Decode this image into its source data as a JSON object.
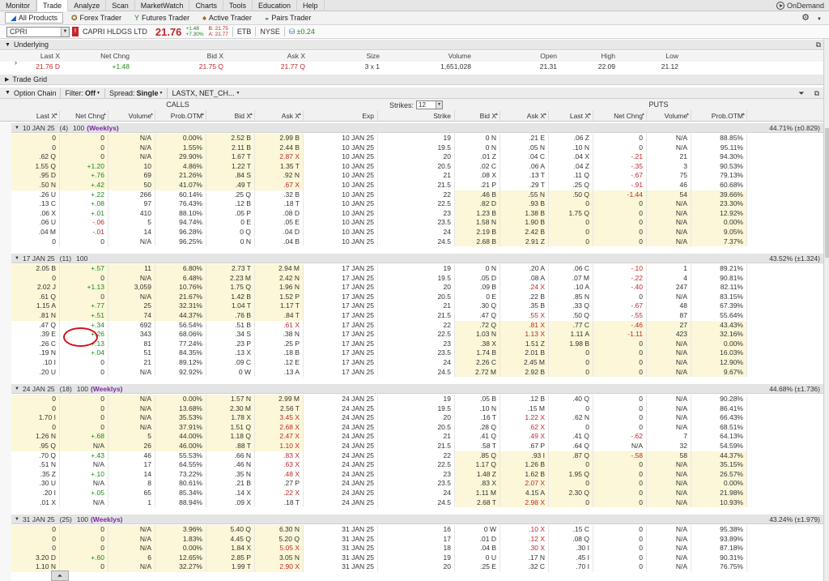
{
  "menu": [
    "Monitor",
    "Trade",
    "Analyze",
    "Scan",
    "MarketWatch",
    "Charts",
    "Tools",
    "Education",
    "Help"
  ],
  "menu_active": "Trade",
  "ondemand": "OnDemand",
  "product_tabs": [
    {
      "label": "All Products",
      "icon": "chart-icon",
      "selected": true
    },
    {
      "label": "Forex Trader",
      "icon": "forex-icon",
      "selected": false
    },
    {
      "label": "Futures Trader",
      "icon": "futures-icon",
      "selected": false
    },
    {
      "label": "Active Trader",
      "icon": "active-trader-icon",
      "selected": false
    },
    {
      "label": "Pairs Trader",
      "icon": "pairs-icon",
      "selected": false
    }
  ],
  "symbol": {
    "ticker": "CPRI",
    "company": "CAPRI HLDGS LTD",
    "last": "21.76",
    "change": "+1.48",
    "change_pct": "+7.30%",
    "bid": "B: 21.75",
    "ask": "A: 21.77",
    "etb": "ETB",
    "exchange": "NYSE",
    "net": "±0.24"
  },
  "underlying": {
    "title": "Underlying",
    "headers": [
      "Last X",
      "Net Chng",
      "Bid X",
      "Ask X",
      "Size",
      "Volume",
      "Open",
      "High",
      "Low"
    ],
    "values": [
      "21.76 D",
      "+1.48",
      "21.75 Q",
      "21.77 Q",
      "3 x 1",
      "1,651,028",
      "21.31",
      "22.09",
      "21.12"
    ]
  },
  "trade_grid": "Trade Grid",
  "chain": {
    "title": "Option Chain",
    "filter_label": "Filter:",
    "filter": "Off",
    "spread_label": "Spread:",
    "spread": "Single",
    "layout": "LASTX, NET_CH...",
    "calls": "CALLS",
    "puts": "PUTS",
    "strikes_label": "Strikes:",
    "strikes": "12",
    "call_headers": [
      "Last X",
      "Net Chng",
      "Volume",
      "Prob.OTM",
      "Bid X",
      "Ask X"
    ],
    "mid_headers": [
      "Exp",
      "Strike"
    ],
    "put_headers": [
      "Bid X",
      "Ask X",
      "Last X",
      "Net Chng",
      "Volume",
      "Prob.OTM"
    ]
  },
  "groups": [
    {
      "exp": "10 JAN 25",
      "days": "(4)",
      "mult": "100",
      "weekly": "(Weeklys)",
      "iv": "44.71% (±0.829)",
      "rows": [
        [
          "0",
          "0",
          "N/A",
          "0.00%",
          "2.52 B",
          "2.99 B",
          "10 JAN 25",
          "19",
          "0 N",
          ".21 E",
          ".06 Z",
          "0",
          "N/A",
          "88.85%"
        ],
        [
          "0",
          "0",
          "N/A",
          "1.55%",
          "2.11 B",
          "2.44 B",
          "10 JAN 25",
          "19.5",
          "0 N",
          ".05 N",
          ".10 N",
          "0",
          "N/A",
          "95.11%"
        ],
        [
          ".62 Q",
          "0",
          "N/A",
          "29.90%",
          "1.67 T",
          "2.87 X",
          "10 JAN 25",
          "20",
          ".01 Z",
          ".04 C",
          ".04 X",
          "-.21",
          "21",
          "94.30%"
        ],
        [
          "1.55 Q",
          "+1.20",
          "10",
          "4.86%",
          "1.22 T",
          "1.35 T",
          "10 JAN 25",
          "20.5",
          ".02 C",
          ".06 A",
          ".04 Z",
          "-.35",
          "3",
          "90.53%"
        ],
        [
          ".95 D",
          "+.76",
          "69",
          "21.26%",
          ".84 S",
          ".92 N",
          "10 JAN 25",
          "21",
          ".08 X",
          ".13 T",
          ".11 Q",
          "-.67",
          "75",
          "79.13%"
        ],
        [
          ".50 N",
          "+.42",
          "50",
          "41.07%",
          ".49 T",
          ".67 X",
          "10 JAN 25",
          "21.5",
          ".21 P",
          ".29 T",
          ".25 Q",
          "-.91",
          "46",
          "60.68%"
        ],
        [
          ".26 U",
          "+.22",
          "266",
          "60.14%",
          ".25 Q",
          ".32 B",
          "10 JAN 25",
          "22",
          ".46 B",
          ".55 N",
          ".50 Q",
          "-1.44",
          "54",
          "39.66%"
        ],
        [
          ".13 C",
          "+.08",
          "97",
          "76.43%",
          ".12 B",
          ".18 T",
          "10 JAN 25",
          "22.5",
          ".82 D",
          ".93 B",
          "0",
          "0",
          "N/A",
          "23.30%"
        ],
        [
          ".06 X",
          "+.01",
          "410",
          "88.10%",
          ".05 P",
          ".08 D",
          "10 JAN 25",
          "23",
          "1.23 B",
          "1.38 B",
          "1.75 Q",
          "0",
          "N/A",
          "12.92%"
        ],
        [
          ".06 U",
          "-.06",
          "5",
          "94.74%",
          "0 E",
          ".05 E",
          "10 JAN 25",
          "23.5",
          "1.58 N",
          "1.90 B",
          "0",
          "0",
          "N/A",
          "0.00%"
        ],
        [
          ".04 M",
          "-.01",
          "14",
          "96.28%",
          "0 Q",
          ".04 D",
          "10 JAN 25",
          "24",
          "2.19 B",
          "2.42 B",
          "0",
          "0",
          "N/A",
          "9.05%"
        ],
        [
          "0",
          "0",
          "N/A",
          "96.25%",
          "0 N",
          ".04 B",
          "10 JAN 25",
          "24.5",
          "2.68 B",
          "2.91 Z",
          "0",
          "0",
          "N/A",
          "7.37%"
        ]
      ]
    },
    {
      "exp": "17 JAN 25",
      "days": "(11)",
      "mult": "100",
      "weekly": "",
      "iv": "43.52% (±1.324)",
      "rows": [
        [
          "2.05 B",
          "+.57",
          "11",
          "6.80%",
          "2.73 T",
          "2.94 M",
          "17 JAN 25",
          "19",
          "0 N",
          ".20 A",
          ".06 C",
          "-.10",
          "1",
          "89.21%"
        ],
        [
          "0",
          "0",
          "N/A",
          "6.48%",
          "2.23 M",
          "2.42 N",
          "17 JAN 25",
          "19.5",
          ".05 D",
          ".08 A",
          ".07 M",
          "-.22",
          "4",
          "90.81%"
        ],
        [
          "2.02 J",
          "+1.13",
          "3,059",
          "10.76%",
          "1.75 Q",
          "1.96 N",
          "17 JAN 25",
          "20",
          ".09 B",
          ".24 X",
          ".10 A",
          "-.40",
          "247",
          "82.11%"
        ],
        [
          ".61 Q",
          "0",
          "N/A",
          "21.67%",
          "1.42 B",
          "1.52 P",
          "17 JAN 25",
          "20.5",
          "0 E",
          ".22 B",
          ".85 N",
          "0",
          "N/A",
          "83.15%"
        ],
        [
          "1.15 A",
          "+.77",
          "25",
          "32.31%",
          "1.04 T",
          "1.17 T",
          "17 JAN 25",
          "21",
          ".30 Q",
          ".35 B",
          ".33 Q",
          "-.67",
          "48",
          "67.39%"
        ],
        [
          ".81 N",
          "+.51",
          "74",
          "44.37%",
          ".76 B",
          ".84 T",
          "17 JAN 25",
          "21.5",
          ".47 Q",
          ".55 X",
          ".50 Q",
          "-.55",
          "87",
          "55.64%"
        ],
        [
          ".47 Q",
          "+.34",
          "692",
          "56.54%",
          ".51 B",
          ".61 X",
          "17 JAN 25",
          "22",
          ".72 Q",
          ".81 X",
          ".77 C",
          "-.46",
          "27",
          "43.43%"
        ],
        [
          ".39 E",
          "+.26",
          "343",
          "68.06%",
          ".34 S",
          ".38 N",
          "17 JAN 25",
          "22.5",
          "1.03 N",
          "1.13 X",
          "1.11 A",
          "-1.11",
          "423",
          "32.16%"
        ],
        [
          ".26 C",
          "+.13",
          "81",
          "77.24%",
          ".23 P",
          ".25 P",
          "17 JAN 25",
          "23",
          ".38 X",
          "1.51 Z",
          "1.98 B",
          "0",
          "N/A",
          "0.00%"
        ],
        [
          ".19 N",
          "+.04",
          "51",
          "84.35%",
          ".13 X",
          ".18 B",
          "17 JAN 25",
          "23.5",
          "1.74 B",
          "2.01 B",
          "0",
          "0",
          "N/A",
          "16.03%"
        ],
        [
          ".10 I",
          "0",
          "21",
          "89.12%",
          ".09 C",
          ".12 E",
          "17 JAN 25",
          "24",
          "2.26 C",
          "2.45 M",
          "0",
          "0",
          "N/A",
          "12.90%"
        ],
        [
          ".20 U",
          "0",
          "N/A",
          "92.92%",
          "0 W",
          ".13 A",
          "17 JAN 25",
          "24.5",
          "2.72 M",
          "2.92 B",
          "0",
          "0",
          "N/A",
          "9.67%"
        ]
      ]
    },
    {
      "exp": "24 JAN 25",
      "days": "(18)",
      "mult": "100",
      "weekly": "(Weeklys)",
      "iv": "44.68% (±1.736)",
      "rows": [
        [
          "0",
          "0",
          "N/A",
          "0.00%",
          "1.57 N",
          "2.99 M",
          "24 JAN 25",
          "19",
          ".05 B",
          ".12 B",
          ".40 Q",
          "0",
          "N/A",
          "90.28%"
        ],
        [
          "0",
          "0",
          "N/A",
          "13.68%",
          "2.30 M",
          "2.56 T",
          "24 JAN 25",
          "19.5",
          ".10 N",
          ".15 M",
          "0",
          "0",
          "N/A",
          "86.41%"
        ],
        [
          "1.70 I",
          "0",
          "N/A",
          "35.53%",
          "1.78 X",
          "3.45 X",
          "24 JAN 25",
          "20",
          ".16 T",
          "1.22 X",
          ".62 N",
          "0",
          "N/A",
          "66.43%"
        ],
        [
          "0",
          "0",
          "N/A",
          "37.91%",
          "1.51 Q",
          "2.68 X",
          "24 JAN 25",
          "20.5",
          ".28 Q",
          ".62 X",
          "0",
          "0",
          "N/A",
          "68.51%"
        ],
        [
          "1.26 N",
          "+.68",
          "5",
          "44.00%",
          "1.18 Q",
          "2.47 X",
          "24 JAN 25",
          "21",
          ".41 Q",
          ".49 X",
          ".41 Q",
          "-.62",
          "7",
          "64.13%"
        ],
        [
          ".95 Q",
          "N/A",
          "26",
          "46.00%",
          ".88 T",
          "1.10 X",
          "24 JAN 25",
          "21.5",
          ".58 T",
          ".67 P",
          ".64 Q",
          "N/A",
          "32",
          "54.59%"
        ],
        [
          ".70 Q",
          "+.43",
          "46",
          "55.53%",
          ".66 N",
          ".83 X",
          "24 JAN 25",
          "22",
          ".85 Q",
          ".93 I",
          ".87 Q",
          "-.58",
          "58",
          "44.37%"
        ],
        [
          ".51 N",
          "N/A",
          "17",
          "64.55%",
          ".46 N",
          ".63 X",
          "24 JAN 25",
          "22.5",
          "1.17 Q",
          "1.26 B",
          "0",
          "0",
          "N/A",
          "35.15%"
        ],
        [
          ".35 Z",
          "+.10",
          "14",
          "73.22%",
          ".35 N",
          ".48 X",
          "24 JAN 25",
          "23",
          "1.48 Z",
          "1.62 B",
          "1.95 Q",
          "0",
          "N/A",
          "26.57%"
        ],
        [
          ".30 U",
          "N/A",
          "8",
          "80.61%",
          ".21 B",
          ".27 P",
          "24 JAN 25",
          "23.5",
          ".83 X",
          "2.07 X",
          "0",
          "0",
          "N/A",
          "0.00%"
        ],
        [
          ".20 I",
          "+.05",
          "65",
          "85.34%",
          ".14 X",
          ".22 X",
          "24 JAN 25",
          "24",
          "1.11 M",
          "4.15 A",
          "2.30 Q",
          "0",
          "N/A",
          "21.98%"
        ],
        [
          ".01 X",
          "N/A",
          "1",
          "88.94%",
          ".09 X",
          ".18 T",
          "24 JAN 25",
          "24.5",
          "2.68 T",
          "2.98 X",
          "0",
          "0",
          "N/A",
          "10.93%"
        ]
      ]
    },
    {
      "exp": "31 JAN 25",
      "days": "(25)",
      "mult": "100",
      "weekly": "(Weeklys)",
      "iv": "43.24% (±1.979)",
      "rows": [
        [
          "0",
          "0",
          "N/A",
          "3.96%",
          "5.40 Q",
          "6.30 N",
          "31 JAN 25",
          "16",
          "0 W",
          ".10 X",
          ".15 C",
          "0",
          "N/A",
          "95.38%"
        ],
        [
          "0",
          "0",
          "N/A",
          "1.83%",
          "4.45 Q",
          "5.20 Q",
          "31 JAN 25",
          "17",
          ".01 D",
          ".12 X",
          ".08 Q",
          "0",
          "N/A",
          "93.89%"
        ],
        [
          "0",
          "0",
          "N/A",
          "0.00%",
          "1.84 X",
          "5.05 X",
          "31 JAN 25",
          "18",
          ".04 B",
          ".30 X",
          ".30 I",
          "0",
          "N/A",
          "87.18%"
        ],
        [
          "3.20 D",
          "+.60",
          "6",
          "12.65%",
          "2.85 P",
          "3.05 N",
          "31 JAN 25",
          "19",
          "0 U",
          ".17 N",
          ".45 I",
          "0",
          "N/A",
          "90.31%"
        ],
        [
          "1.10 N",
          "0",
          "N/A",
          "32.27%",
          "1.99 T",
          "2.90 X",
          "31 JAN 25",
          "20",
          ".25 E",
          ".32 C",
          ".70 I",
          "0",
          "N/A",
          "76.75%"
        ]
      ]
    }
  ]
}
